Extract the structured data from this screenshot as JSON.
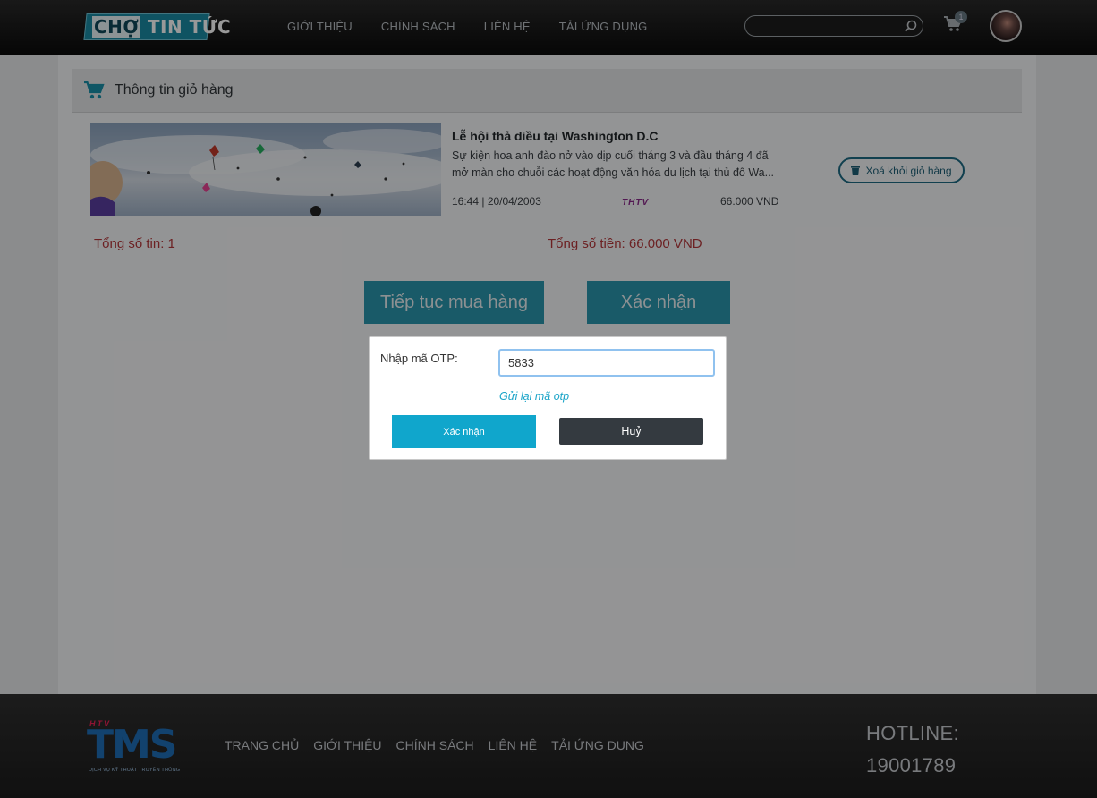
{
  "header": {
    "logo_text_1": "CHỢ",
    "logo_text_2": "TIN TỨC",
    "nav": [
      "GIỚI THIỆU",
      "CHÍNH SÁCH",
      "LIÊN HỆ",
      "TẢI ỨNG DỤNG"
    ],
    "search_value": "",
    "cart_count": "1"
  },
  "cart": {
    "title": "Thông tin giỏ hàng",
    "item": {
      "title": "Lễ hội thả diều tại Washington D.C",
      "desc_line1": "Sự kiện hoa anh đào nở vào dịp cuối tháng 3 và đầu tháng 4 đã",
      "desc_line2": "mở màn cho chuỗi các hoạt động văn hóa du lịch tại thủ đô Wa...",
      "time": "16:44 | 20/04/2003",
      "channel": "THTV",
      "price": "66.000 VND",
      "remove_label": "Xoá khỏi giỏ hàng"
    },
    "total_count": "Tổng số tin: 1",
    "total_price": "Tổng số tiền: 66.000 VND",
    "continue_label": "Tiếp tục mua hàng",
    "confirm_label": "Xác nhận"
  },
  "otp_dialog": {
    "label": "Nhập mã OTP:",
    "value": "5833",
    "resend": "Gửi lại mã otp",
    "confirm": "Xác nhận",
    "cancel": "Huỷ"
  },
  "footer": {
    "logo_top": "HTV",
    "logo_main": "TMS",
    "logo_sub": "DỊCH VỤ KỸ THUẬT TRUYỀN THÔNG",
    "nav": [
      "TRANG CHỦ",
      "GIỚI THIỆU",
      "CHÍNH SÁCH",
      "LIÊN HỆ",
      "TẢI ỨNG DỤNG"
    ],
    "hotline_label": "HOTLINE:",
    "hotline_number": "19001789"
  },
  "colors": {
    "accent": "#2b97ad",
    "danger_text": "#b4373b",
    "dialog_confirm": "#10a6cc",
    "dialog_cancel": "#343a40"
  }
}
